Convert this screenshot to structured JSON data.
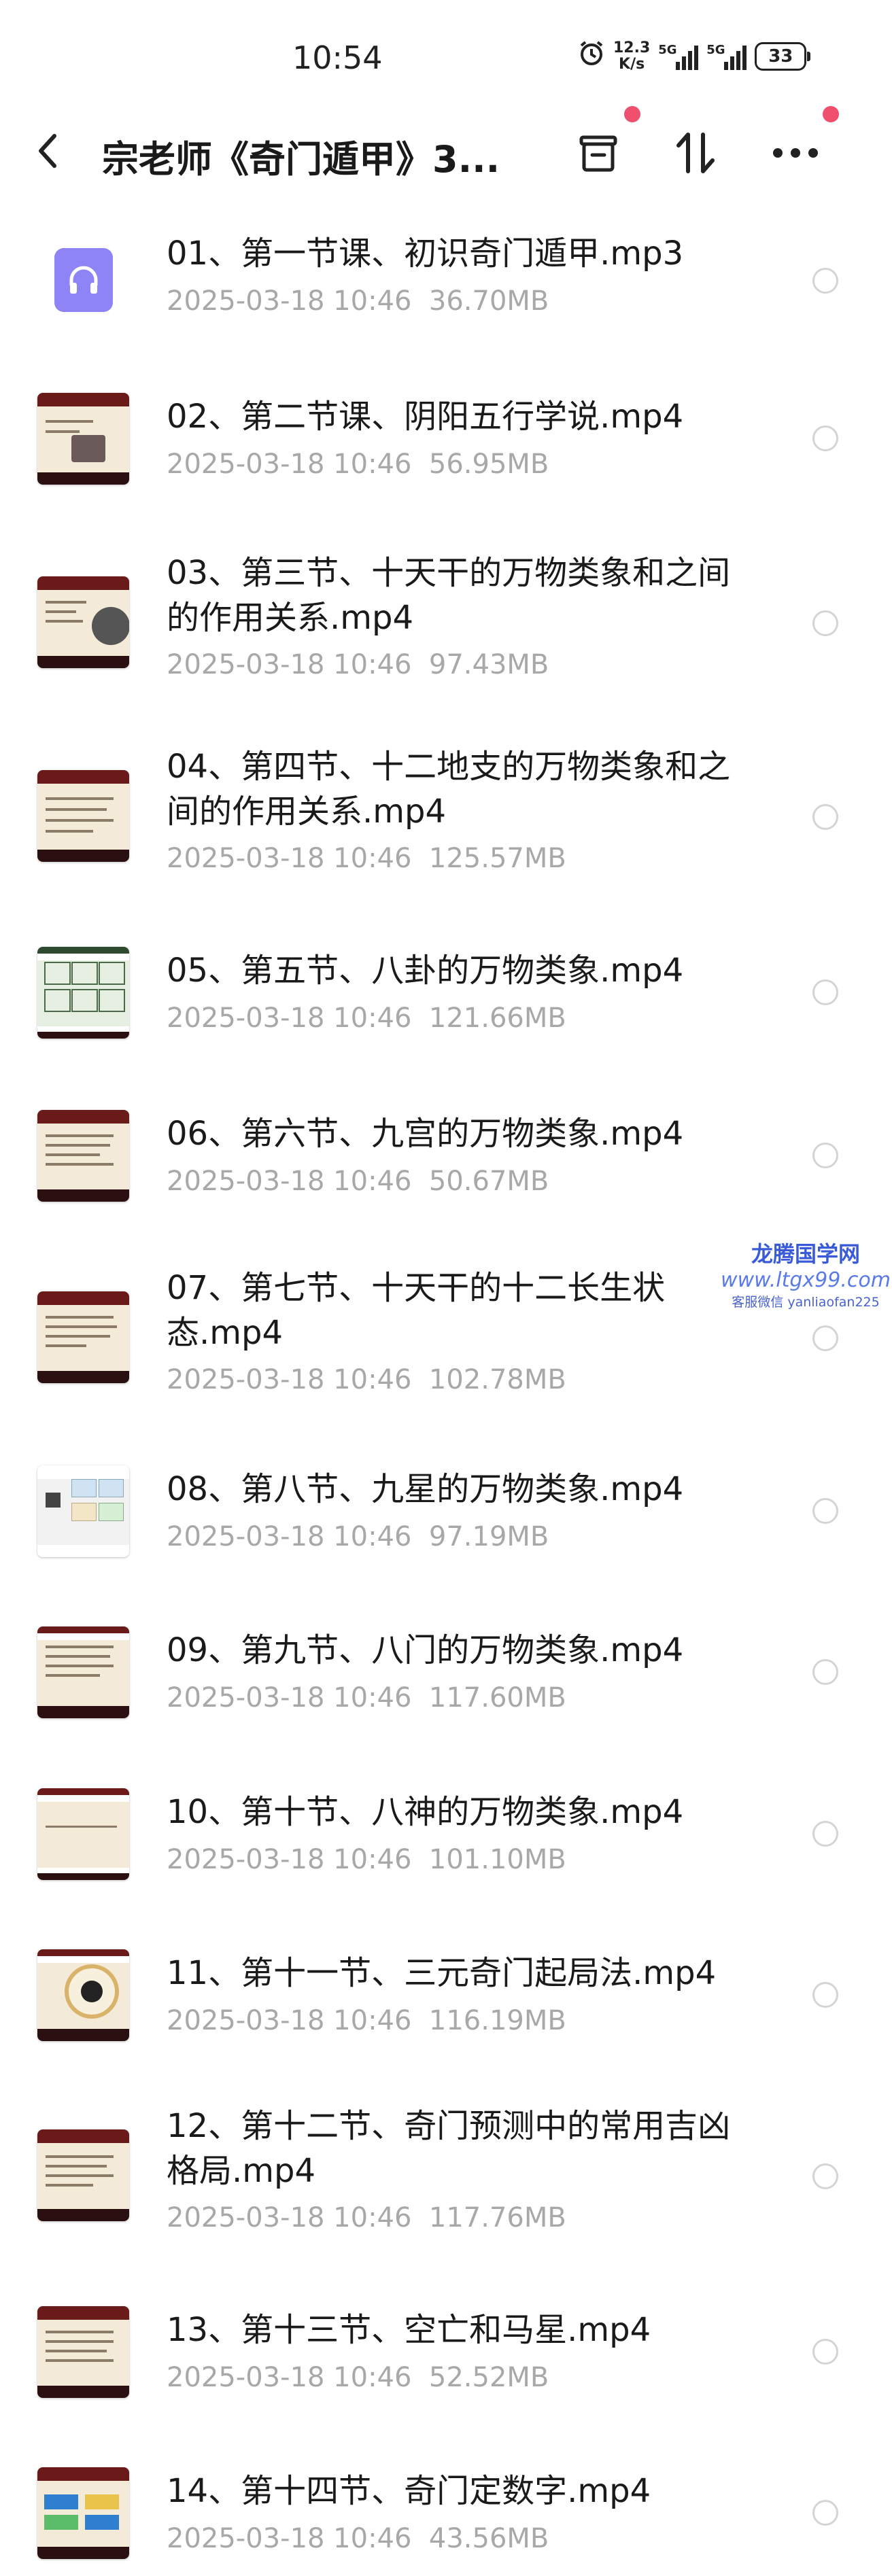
{
  "status_bar": {
    "time": "10:54",
    "net_speed_value": "12.3",
    "net_speed_unit": "K/s",
    "signal1_label": "5G",
    "signal2_label": "5G",
    "battery": "33"
  },
  "header": {
    "title": "宗老师《奇门遁甲》3..."
  },
  "files": [
    {
      "name": "01、第一节课、初识奇门遁甲.mp3",
      "date": "2025-03-18  10:46",
      "size": "36.70MB",
      "type": "audio"
    },
    {
      "name": "02、第二节课、阴阳五行学说.mp4",
      "date": "2025-03-18  10:46",
      "size": "56.95MB",
      "type": "video"
    },
    {
      "name": "03、第三节、十天干的万物类象和之间的作用关系.mp4",
      "date": "2025-03-18  10:46",
      "size": "97.43MB",
      "type": "video"
    },
    {
      "name": "04、第四节、十二地支的万物类象和之间的作用关系.mp4",
      "date": "2025-03-18  10:46",
      "size": "125.57MB",
      "type": "video"
    },
    {
      "name": "05、第五节、八卦的万物类象.mp4",
      "date": "2025-03-18  10:46",
      "size": "121.66MB",
      "type": "video"
    },
    {
      "name": "06、第六节、九宫的万物类象.mp4",
      "date": "2025-03-18  10:46",
      "size": "50.67MB",
      "type": "video"
    },
    {
      "name": "07、第七节、十天干的十二长生状态.mp4",
      "date": "2025-03-18  10:46",
      "size": "102.78MB",
      "type": "video"
    },
    {
      "name": "08、第八节、九星的万物类象.mp4",
      "date": "2025-03-18  10:46",
      "size": "97.19MB",
      "type": "video"
    },
    {
      "name": "09、第九节、八门的万物类象.mp4",
      "date": "2025-03-18  10:46",
      "size": "117.60MB",
      "type": "video"
    },
    {
      "name": "10、第十节、八神的万物类象.mp4",
      "date": "2025-03-18  10:46",
      "size": "101.10MB",
      "type": "video"
    },
    {
      "name": "11、第十一节、三元奇门起局法.mp4",
      "date": "2025-03-18  10:46",
      "size": "116.19MB",
      "type": "video"
    },
    {
      "name": "12、第十二节、奇门预测中的常用吉凶格局.mp4",
      "date": "2025-03-18  10:46",
      "size": "117.76MB",
      "type": "video"
    },
    {
      "name": "13、第十三节、空亡和马星.mp4",
      "date": "2025-03-18  10:46",
      "size": "52.52MB",
      "type": "video"
    },
    {
      "name": "14、第十四节、奇门定数字.mp4",
      "date": "2025-03-18  10:46",
      "size": "43.56MB",
      "type": "video"
    }
  ],
  "watermark": {
    "line1": "龙腾国学网",
    "line2": "www.ltgx99.com",
    "line3": "客服微信 yanliaofan225"
  },
  "colors": {
    "accent_dot": "#f0506e",
    "audio_icon": "#8f84f5",
    "meta_text": "#a8a8a8"
  }
}
